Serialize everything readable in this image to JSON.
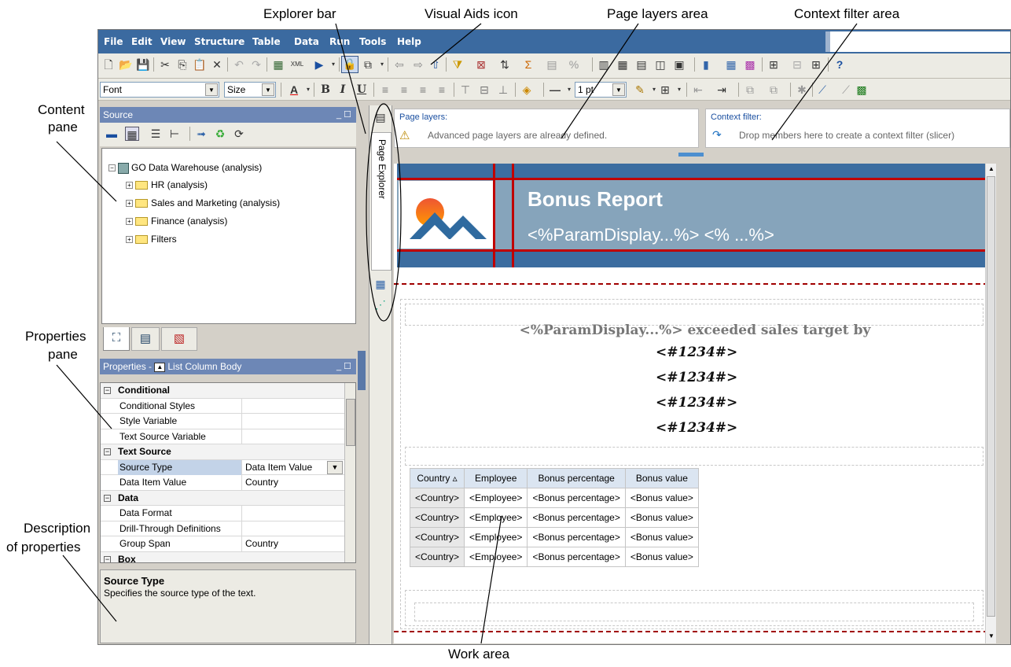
{
  "annotations": {
    "explorer_bar": "Explorer bar",
    "visual_aids_icon": "Visual Aids icon",
    "page_layers_area": "Page layers area",
    "context_filter_area": "Context filter area",
    "content_pane_1": "Content",
    "content_pane_2": "pane",
    "properties_pane_1": "Properties",
    "properties_pane_2": "pane",
    "description_1": "Description",
    "description_2": "of properties",
    "work_area": "Work area"
  },
  "menu": [
    "File",
    "Edit",
    "View",
    "Structure",
    "Table",
    "Data",
    "Run",
    "Tools",
    "Help"
  ],
  "format_toolbar": {
    "font": "Font",
    "size": "Size",
    "line_width": "1 pt"
  },
  "source_pane": {
    "title": "Source",
    "root": "GO Data Warehouse (analysis)",
    "items": [
      "HR (analysis)",
      "Sales and Marketing (analysis)",
      "Finance (analysis)",
      "Filters"
    ]
  },
  "properties_pane": {
    "title": "Properties - ",
    "subject": "List Column Body",
    "rows": [
      {
        "key": "Conditional",
        "value": "",
        "category": true
      },
      {
        "key": "Conditional Styles",
        "value": ""
      },
      {
        "key": "Style Variable",
        "value": ""
      },
      {
        "key": "Text Source Variable",
        "value": ""
      },
      {
        "key": "Text Source",
        "value": "",
        "category": true
      },
      {
        "key": "Source Type",
        "value": "Data Item Value",
        "selected": true
      },
      {
        "key": "Data Item Value",
        "value": "Country"
      },
      {
        "key": "Data",
        "value": "",
        "category": true
      },
      {
        "key": "Data Format",
        "value": ""
      },
      {
        "key": "Drill-Through Definitions",
        "value": ""
      },
      {
        "key": "Group Span",
        "value": "Country"
      },
      {
        "key": "Box",
        "value": "",
        "category": true
      }
    ]
  },
  "description": {
    "title": "Source Type",
    "text": "Specifies the source type of the text."
  },
  "explorer": {
    "label": "Page Explorer"
  },
  "page_layers": {
    "label": "Page layers:",
    "message": "Advanced page layers are already defined."
  },
  "context_filter": {
    "label": "Context filter:",
    "message": "Drop members here to create a context filter (slicer)"
  },
  "report": {
    "title": "Bonus Report",
    "subtitle": "<%ParamDisplay...%>   <% ...%>",
    "headline": "<%ParamDisplay...%> exceeded sales target by",
    "values": [
      "<#1234#>",
      "<#1234#>",
      "<#1234#>",
      "<#1234#>"
    ],
    "table": {
      "headers": [
        "Country ▵",
        "Employee",
        "Bonus percentage",
        "Bonus value"
      ],
      "rows": [
        [
          "<Country>",
          "<Employee>",
          "<Bonus percentage>",
          "<Bonus value>"
        ],
        [
          "<Country>",
          "<Employee>",
          "<Bonus percentage>",
          "<Bonus value>"
        ],
        [
          "<Country>",
          "<Employee>",
          "<Bonus percentage>",
          "<Bonus value>"
        ],
        [
          "<Country>",
          "<Employee>",
          "<Bonus percentage>",
          "<Bonus value>"
        ]
      ]
    }
  },
  "colors": {
    "menubar": "#3b6aa0",
    "header_band": "#3c6da0",
    "header_body": "#86a4bb",
    "accent_red": "#c00000"
  }
}
